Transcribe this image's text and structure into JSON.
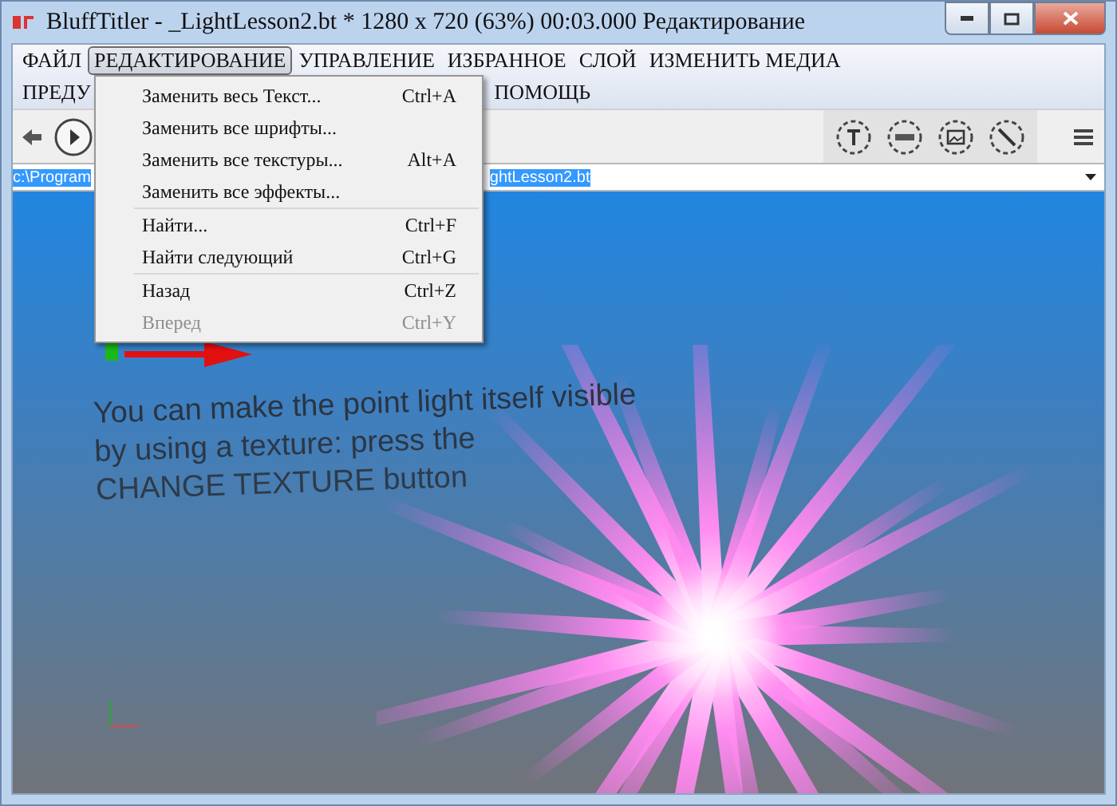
{
  "window": {
    "title": "BluffTitler - _LightLesson2.bt * 1280 x 720 (63%) 00:03.000 Редактирование"
  },
  "menubar": {
    "items": [
      {
        "label": "ФАЙЛ",
        "selected": false
      },
      {
        "label": "РЕДАКТИРОВАНИЕ",
        "selected": true
      },
      {
        "label": "УПРАВЛЕНИЕ",
        "selected": false
      },
      {
        "label": "ИЗБРАННОЕ",
        "selected": false
      },
      {
        "label": "СЛОЙ",
        "selected": false
      },
      {
        "label": "ИЗМЕНИТЬ МЕДИА",
        "selected": false
      },
      {
        "label": "ПРЕДУ",
        "selected": false
      },
      {
        "label": "ПОМОЩЬ",
        "selected": false
      }
    ]
  },
  "dropdown": {
    "groups": [
      [
        {
          "label": "Заменить весь Текст...",
          "shortcut": "Ctrl+A",
          "disabled": false
        },
        {
          "label": "Заменить все шрифты...",
          "disabled": false
        },
        {
          "label": "Заменить все текстуры...",
          "shortcut": "Alt+A",
          "disabled": false
        },
        {
          "label": "Заменить все эффекты...",
          "disabled": false
        }
      ],
      [
        {
          "label": "Найти...",
          "shortcut": "Ctrl+F",
          "disabled": false
        },
        {
          "label": "Найти следующий",
          "shortcut": "Ctrl+G",
          "disabled": false
        }
      ],
      [
        {
          "label": "Назад",
          "shortcut": "Ctrl+Z",
          "disabled": false
        },
        {
          "label": "Вперед",
          "shortcut": "Ctrl+Y",
          "disabled": true
        }
      ]
    ]
  },
  "path_field": {
    "value_start": "c:\\Program",
    "value_end": "ghtLesson2.bt"
  },
  "scene": {
    "lines": [
      "You can make the point light itself visible",
      "by using a texture: press the",
      "CHANGE TEXTURE button"
    ]
  }
}
